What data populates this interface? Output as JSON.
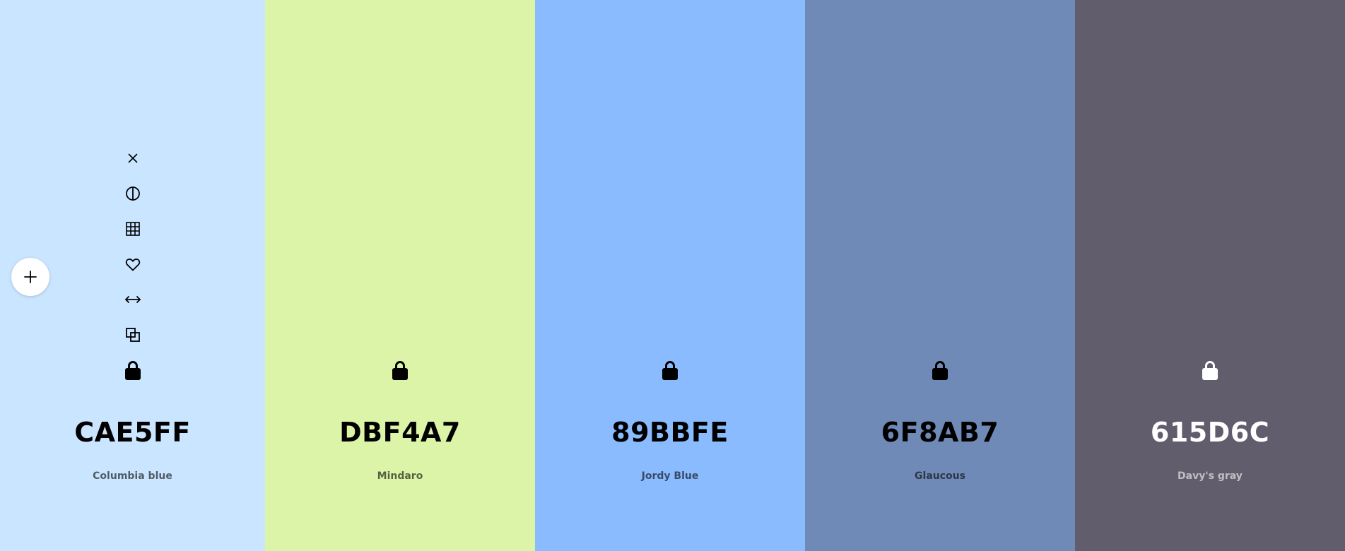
{
  "swatches": [
    {
      "hex": "CAE5FF",
      "name": "Columbia blue",
      "bg": "#CAE5FF",
      "fg": "#000000",
      "show_tools": true
    },
    {
      "hex": "DBF4A7",
      "name": "Mindaro",
      "bg": "#DBF4A7",
      "fg": "#000000",
      "show_tools": false
    },
    {
      "hex": "89BBFE",
      "name": "Jordy Blue",
      "bg": "#89BBFE",
      "fg": "#000000",
      "show_tools": false
    },
    {
      "hex": "6F8AB7",
      "name": "Glaucous",
      "bg": "#6F8AB7",
      "fg": "#000000",
      "show_tools": false
    },
    {
      "hex": "615D6C",
      "name": "Davy's gray",
      "bg": "#615D6C",
      "fg": "#FFFFFF",
      "show_tools": false
    }
  ],
  "tools": [
    "close-icon",
    "contrast-icon",
    "grid-icon",
    "heart-icon",
    "drag-icon",
    "copy-icon"
  ],
  "add_button": {
    "icon": "plus-icon"
  }
}
